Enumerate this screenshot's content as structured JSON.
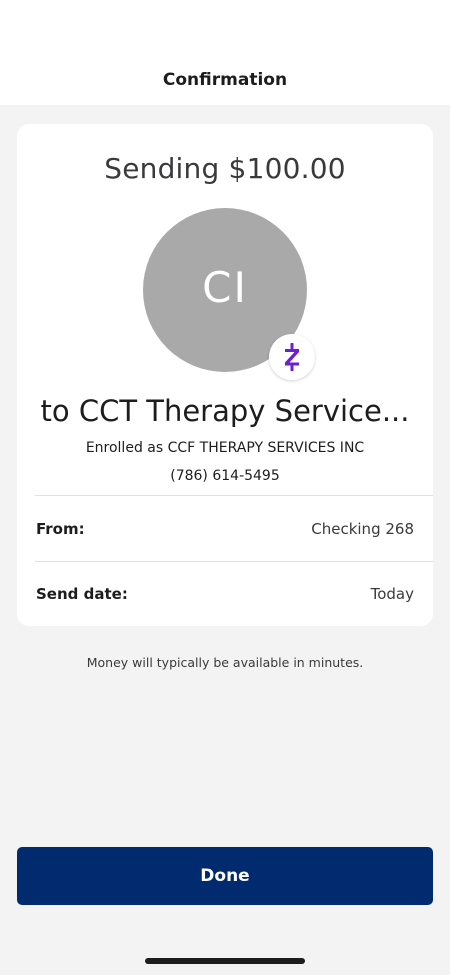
{
  "header": {
    "title": "Confirmation"
  },
  "summary": {
    "sending_text": "Sending $100.00",
    "avatar_initials": "CI",
    "badge_icon": "zelle-icon",
    "recipient": "to CCT Therapy Service...",
    "enrolled_as": "Enrolled as CCF THERAPY SERVICES INC",
    "phone": "(786) 614-5495"
  },
  "details": {
    "from_label": "From:",
    "from_value": "Checking 268",
    "send_date_label": "Send date:",
    "send_date_value": "Today"
  },
  "note": "Money will typically be available in minutes.",
  "actions": {
    "done_label": "Done"
  },
  "colors": {
    "primary": "#022a6e",
    "zelle_purple": "#6d1ed4",
    "avatar_gray": "#a9a9a9"
  }
}
